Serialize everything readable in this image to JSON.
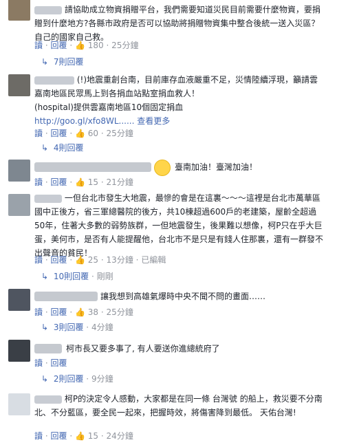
{
  "labels": {
    "read": "讀",
    "reply": "回覆",
    "dot": "·",
    "see_more": "查看更多",
    "edited": "已編輯"
  },
  "comments": [
    {
      "text": "請協助成立物資捐贈平台，我們需要知道災民目前需要什麼物資，要捐贈到什麼地方?各縣市政府是否可以協助將捐贈物資集中整合後統一送入災區？自己的國家自己救。",
      "likes": "180",
      "time": "25分鐘",
      "replies": "7則回覆"
    },
    {
      "text": "(!)地震重創台南，目前庫存血液嚴重不足，災情陸續浮現，籲請雲嘉南地區民眾馬上到各捐血站點室捐血救人！",
      "text2": "(hospital)提供雲嘉南地區10個固定捐血",
      "link": "http://goo.gl/xfo8WL......",
      "likes": "60",
      "time": "25分鐘",
      "replies": "4則回覆"
    },
    {
      "text": "臺南加油！臺灣加油！",
      "likes": "15",
      "time": "21分鐘"
    },
    {
      "text": "一但台北市發生大地震，最慘的會是在這裏～～～這裡是台北市萬華區國中正後方，省三軍總醫院的後方，共10棟超過600戶的老建築，屋齡全超過50年，住著大多數的弱勢族群，一但地震發生，後果難以想像，柯P只在乎大巨蛋，美何市，是否有人能提醒他，台北市不是只是有錢人住那裏，還有一群發不出聲音的貧民！",
      "likes": "25",
      "time": "13分鐘",
      "replies": "10則回覆",
      "reply_time": "剛剛"
    },
    {
      "text": "讓我想到高雄氣爆時中央不聞不問的畫面……",
      "likes": "38",
      "time": "25分鐘",
      "replies": "3則回覆",
      "reply_time": "4分鐘"
    },
    {
      "text": "柯市長又要多事了, 有人要送你進總統府了",
      "replies": "2則回覆",
      "reply_time": "9分鐘"
    },
    {
      "text": "柯P的決定令人感動，大家都是在同一條 台灣號 的船上，救災要不分南北、不分藍區，要全民一起來，把握時效，將傷害降到最低。 天佑台灣!",
      "likes": "15",
      "time": "24分鐘"
    }
  ]
}
